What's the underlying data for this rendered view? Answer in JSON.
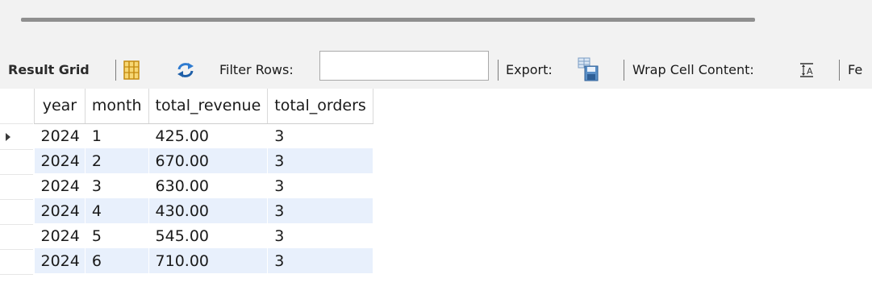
{
  "toolbar": {
    "result_grid_label": "Result Grid",
    "filter_rows_label": "Filter Rows:",
    "filter_rows_value": "",
    "export_label": "Export:",
    "wrap_cell_label": "Wrap Cell Content:",
    "fetch_label": "Fe",
    "icons": {
      "grid": "grid-layout-icon",
      "refresh": "refresh-icon",
      "export": "export-icon",
      "wrap": "wrap-cell-icon"
    },
    "colors": {
      "grid_icon": "#e6a817",
      "refresh_icon": "#2f7bd0",
      "export_icon": "#5a8fc7"
    }
  },
  "result": {
    "columns": [
      "year",
      "month",
      "total_revenue",
      "total_orders"
    ],
    "rows": [
      [
        "2024",
        "1",
        "425.00",
        "3"
      ],
      [
        "2024",
        "2",
        "670.00",
        "3"
      ],
      [
        "2024",
        "3",
        "630.00",
        "3"
      ],
      [
        "2024",
        "4",
        "430.00",
        "3"
      ],
      [
        "2024",
        "5",
        "545.00",
        "3"
      ],
      [
        "2024",
        "6",
        "710.00",
        "3"
      ]
    ],
    "selected_row": 0,
    "stripe_color": "#e8f0fc"
  }
}
